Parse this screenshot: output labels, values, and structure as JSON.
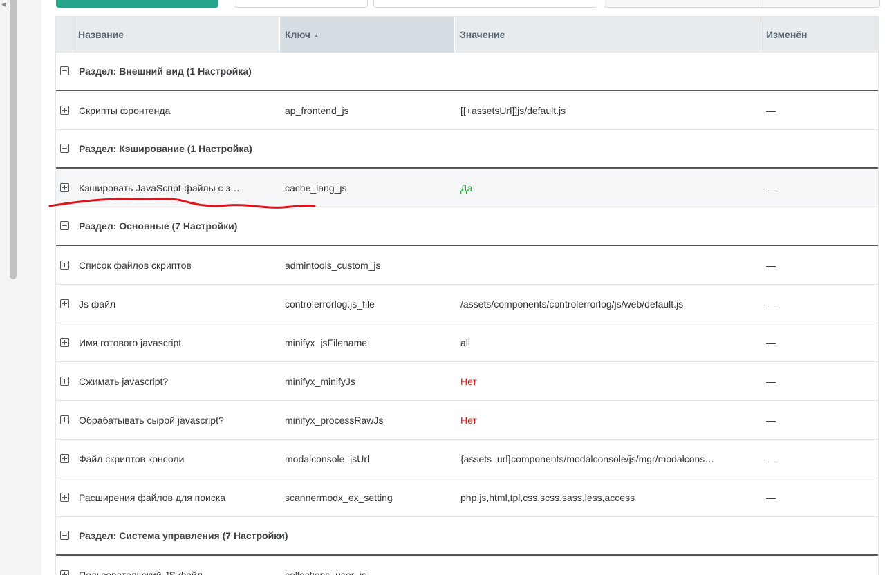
{
  "nav": {
    "left_arrow_icon": "chevron-left-icon"
  },
  "columns": {
    "name": "Название",
    "key": "Ключ",
    "value": "Значение",
    "modified": "Изменён",
    "key_sort_icon": "sort-up-icon"
  },
  "groups": [
    {
      "title": "Раздел: Внешний вид (1 Настройка)",
      "rows": [
        {
          "name": "Скрипты фронтенда",
          "key": "ap_frontend_js",
          "value": "[[+assetsUrl]]js/default.js",
          "modified": "—"
        }
      ]
    },
    {
      "title": "Раздел: Кэширование (1 Настройка)",
      "rows": [
        {
          "name": "Кэшировать JavaScript-файлы с з…",
          "key": "cache_lang_js",
          "value": "Да",
          "modified": "—"
        }
      ]
    },
    {
      "title": "Раздел: Основные (7 Настройки)",
      "rows": [
        {
          "name": "Список файлов скриптов",
          "key": "admintools_custom_js",
          "value": "",
          "modified": "—"
        },
        {
          "name": "Js файл",
          "key": "controlerrorlog.js_file",
          "value": "/assets/components/controlerrorlog/js/web/default.js",
          "modified": "—"
        },
        {
          "name": "Имя готового javascript",
          "key": "minifyx_jsFilename",
          "value": "all",
          "modified": "—"
        },
        {
          "name": "Сжимать javascript?",
          "key": "minifyx_minifyJs",
          "value": "Нет",
          "modified": "—"
        },
        {
          "name": "Обрабатывать сырой javascript?",
          "key": "minifyx_processRawJs",
          "value": "Нет",
          "modified": "—"
        },
        {
          "name": "Файл скриптов консоли",
          "key": "modalconsole_jsUrl",
          "value": "{assets_url}components/modalconsole/js/mgr/modalcons…",
          "modified": "—"
        },
        {
          "name": "Расширения файлов для поиска",
          "key": "scannermodx_ex_setting",
          "value": "php,js,html,tpl,css,scss,sass,less,access",
          "modified": "—"
        }
      ]
    },
    {
      "title": "Раздел: Система управления (7 Настройки)",
      "rows": [
        {
          "name": "Пользовательский JS файл",
          "key": "collections_user_js",
          "value": "",
          "modified": ""
        }
      ]
    }
  ],
  "colors": {
    "accent_green": "#27a58a",
    "yes": "#2eaa3c",
    "no": "#d0211b",
    "annotation_red": "#e0151b"
  }
}
